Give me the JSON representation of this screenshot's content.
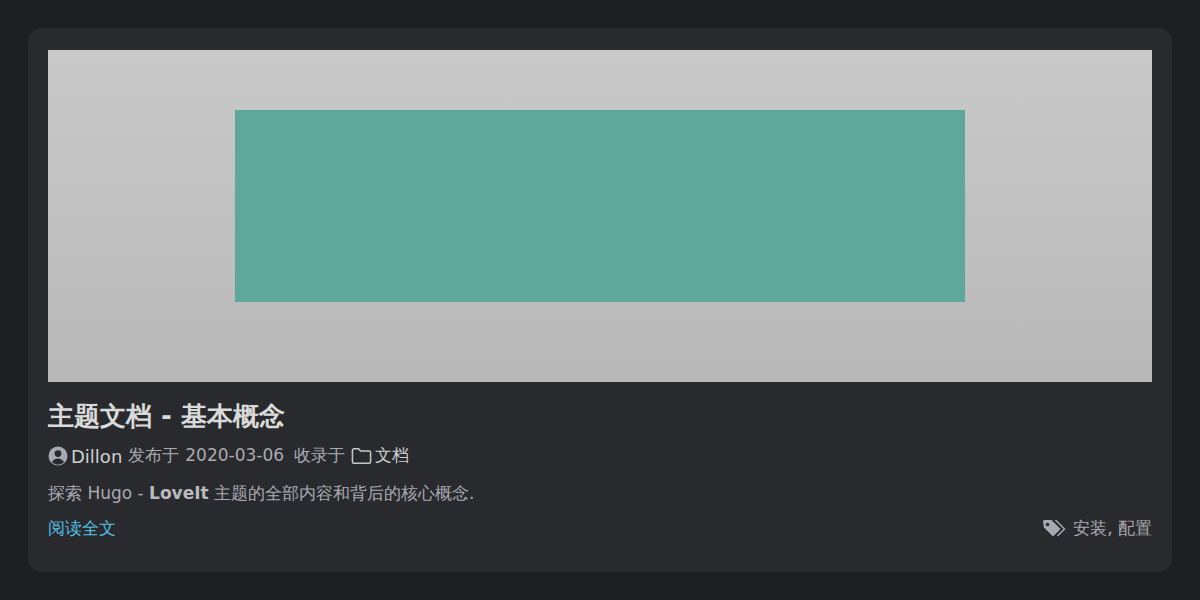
{
  "post": {
    "title": "主题文档 - 基本概念",
    "meta": {
      "author": "Dillon",
      "published_label": "发布于",
      "date": "2020-03-06",
      "category_label": "收录于",
      "category": "文档"
    },
    "summary": [
      {
        "text": "探索 Hugo - ",
        "bold": false
      },
      {
        "text": "LoveIt",
        "bold": true
      },
      {
        "text": " 主题的全部内容和背后的核心概念.",
        "bold": false
      }
    ],
    "read_more": "阅读全文",
    "tags": [
      "安装",
      "配置"
    ],
    "tag_separator": ", "
  }
}
